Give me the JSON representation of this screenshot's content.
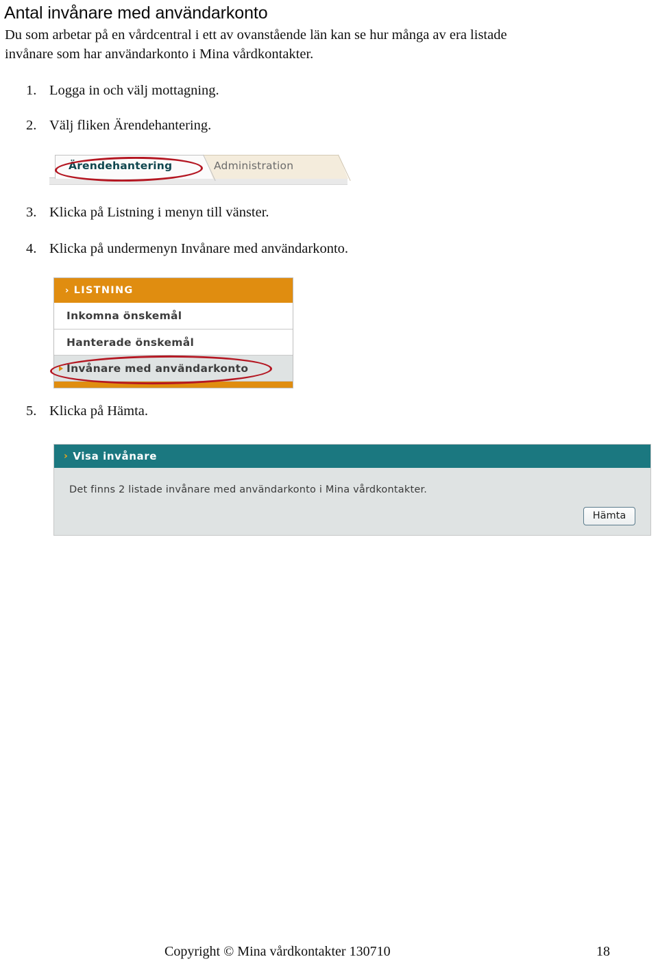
{
  "document": {
    "title": "Antal invånare med användarkonto",
    "intro_line1": "Du som arbetar på en vårdcentral i ett av ovanstående län kan se hur många av era listade",
    "intro_line2": "invånare som har användarkonto i Mina vårdkontakter."
  },
  "steps": [
    {
      "num": "1.",
      "text": "Logga in och välj mottagning."
    },
    {
      "num": "2.",
      "text": "Välj fliken Ärendehantering."
    },
    {
      "num": "3.",
      "text": "Klicka på Listning i menyn till vänster."
    },
    {
      "num": "4.",
      "text": "Klicka på undermenyn Invånare med användarkonto."
    },
    {
      "num": "5.",
      "text": "Klicka på Hämta."
    }
  ],
  "tabs_screenshot": {
    "active_tab": "Ärendehantering",
    "inactive_tab": "Administration",
    "active_text_color": "#10474f",
    "inactive_bg_color": "#f4ecdc",
    "annotation_color": "#b41722"
  },
  "menu_screenshot": {
    "header_chevron": "›",
    "header_label": "LISTNING",
    "header_bg_color": "#e08d10",
    "items": [
      {
        "label": "Inkomna önskemål",
        "selected": false
      },
      {
        "label": "Hanterade önskemål",
        "selected": false
      },
      {
        "label": "Invånare med användarkonto",
        "selected": true
      }
    ],
    "selected_bg_color": "#dfe3e3",
    "annotation_color": "#b41722"
  },
  "panel_screenshot": {
    "header_chevron": "›",
    "header_label": "Visa invånare",
    "header_bg_color": "#1b7880",
    "body_text": "Det finns 2 listade invånare med användarkonto i Mina vårdkontakter.",
    "button_label": "Hämta",
    "count": "2"
  },
  "footer": {
    "copyright": "Copyright © Mina vårdkontakter 130710",
    "page_number": "18"
  }
}
